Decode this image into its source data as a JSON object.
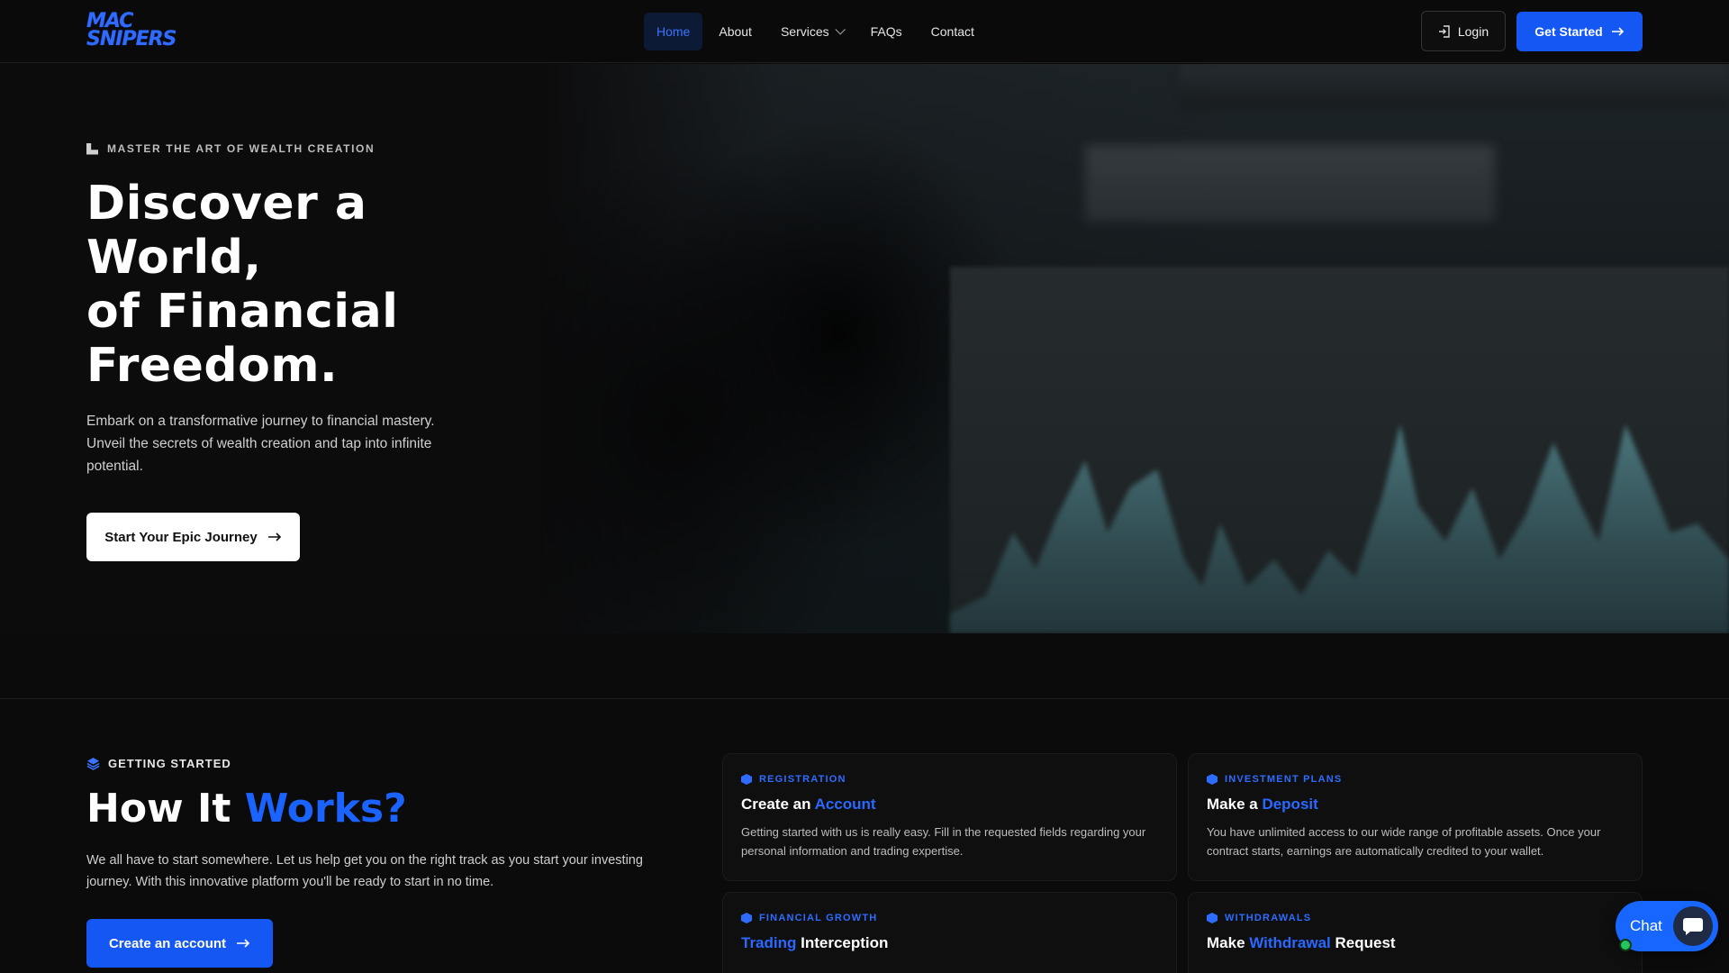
{
  "nav": {
    "logo_line1": "MAC",
    "logo_line2": "SNIPERS",
    "links": [
      {
        "label": "Home",
        "active": true
      },
      {
        "label": "About"
      },
      {
        "label": "Services",
        "has_dropdown": true
      },
      {
        "label": "FAQs"
      },
      {
        "label": "Contact"
      }
    ],
    "login_label": "Login",
    "login_icon": "login-icon",
    "get_started_label": "Get Started"
  },
  "hero": {
    "eyebrow": "MASTER THE ART OF WEALTH CREATION",
    "title_lines": [
      "Discover a",
      "World,",
      "of Financial",
      "Freedom."
    ],
    "subtitle": "Embark on a transformative journey to financial mastery. Unveil the secrets of wealth creation and tap into infinite potential.",
    "cta_label": "Start Your Epic Journey"
  },
  "how": {
    "eyebrow": "GETTING STARTED",
    "title_plain": "How It ",
    "title_accent": "Works?",
    "subtitle": "We all have to start somewhere. Let us help get you on the right track as you start your investing journey. With this innovative platform you'll be ready to start in no time.",
    "cta_label": "Create an account",
    "cards": [
      {
        "tag": "REGISTRATION",
        "title_pre": "Create an ",
        "title_accent": "Account",
        "title_post": "",
        "desc": "Getting started with us is really easy. Fill in the requested fields regarding your personal information and trading expertise."
      },
      {
        "tag": "INVESTMENT PLANS",
        "title_pre": "Make a ",
        "title_accent": "Deposit",
        "title_post": "",
        "desc": "You have unlimited access to our wide range of profitable assets. Once your contract starts, earnings are automatically credited to your wallet."
      },
      {
        "tag": "FINANCIAL GROWTH",
        "title_pre": "",
        "title_accent": "Trading",
        "title_post": " Interception",
        "desc": ""
      },
      {
        "tag": "WITHDRAWALS",
        "title_pre": "Make ",
        "title_accent": "Withdrawal",
        "title_post": " Request",
        "desc": ""
      }
    ]
  },
  "chat": {
    "label": "Chat"
  },
  "colors": {
    "accent": "#1557f2",
    "accent_text": "#2e6cff",
    "background": "#0b0b0c"
  }
}
